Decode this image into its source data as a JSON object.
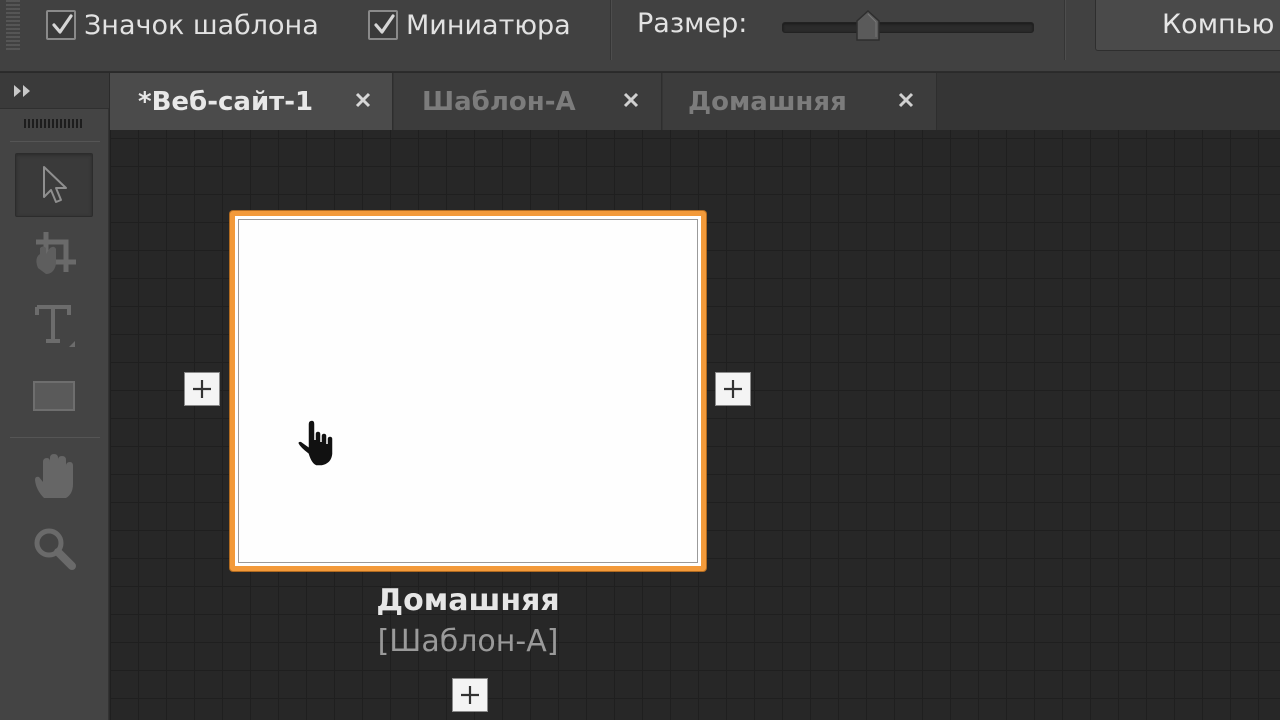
{
  "options_bar": {
    "checkbox_template_icon": {
      "label": "Значок шаблона",
      "checked": true
    },
    "checkbox_thumbnail": {
      "label": "Миниатюра",
      "checked": true
    },
    "size_label": "Размер:",
    "size_slider_fraction": 0.34,
    "view_dropdown_label": "Компью"
  },
  "tabs": [
    {
      "label": "*Веб-сайт-1",
      "active": true
    },
    {
      "label": "Шаблон-А",
      "active": false
    },
    {
      "label": "Домашняя",
      "active": false
    }
  ],
  "toolbar": {
    "tools": [
      "selection-tool",
      "crop-tool",
      "text-tool",
      "rectangle-tool",
      "hand-tool",
      "zoom-tool"
    ],
    "active_tool": "selection-tool"
  },
  "canvas": {
    "page": {
      "name": "Домашняя",
      "template": "[Шаблон-А]"
    }
  },
  "colors": {
    "selection_accent": "#f39a3a",
    "ui_background": "#414141",
    "canvas_background": "#272727"
  }
}
